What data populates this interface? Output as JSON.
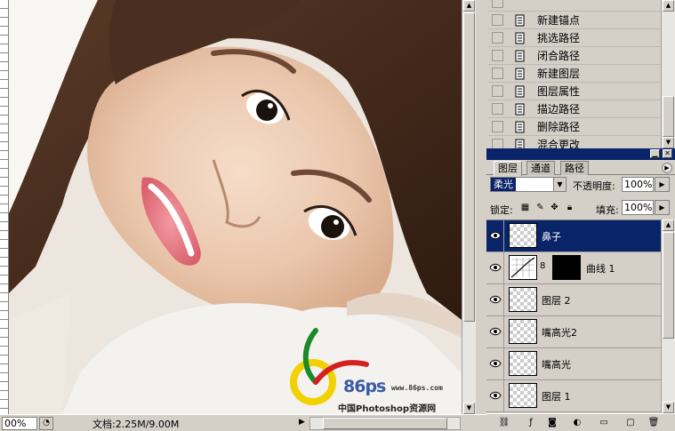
{
  "document": {
    "zoom": "00%",
    "doc_info": "文档:2.25M/9.00M"
  },
  "watermark": {
    "brand": "86ps",
    "url": "www.86ps.com",
    "site_name": "中国Photoshop资源网"
  },
  "history": {
    "items": [
      {
        "label": "新建锚点",
        "icon": "history-state-icon"
      },
      {
        "label": "挑选路径",
        "icon": "history-state-icon"
      },
      {
        "label": "闭合路径",
        "icon": "history-state-icon"
      },
      {
        "label": "新建图层",
        "icon": "history-state-icon"
      },
      {
        "label": "图层属性",
        "icon": "history-state-icon"
      },
      {
        "label": "描边路径",
        "icon": "history-state-icon"
      },
      {
        "label": "删除路径",
        "icon": "history-state-icon"
      },
      {
        "label": "混合更改",
        "icon": "history-state-icon"
      }
    ]
  },
  "layers_panel": {
    "tabs": [
      "图层",
      "通道",
      "路径"
    ],
    "active_tab": "图层",
    "blend_mode": "柔光",
    "opacity_label": "不透明度:",
    "opacity": "100%",
    "lock_label": "锁定:",
    "fill_label": "填充:",
    "fill": "100%",
    "layers": [
      {
        "name": "鼻子",
        "selected": true,
        "visible": true,
        "type": "pixel"
      },
      {
        "name": "曲线 1",
        "selected": false,
        "visible": true,
        "type": "adjustment"
      },
      {
        "name": "图层 2",
        "selected": false,
        "visible": true,
        "type": "pixel"
      },
      {
        "name": "嘴高光2",
        "selected": false,
        "visible": true,
        "type": "pixel"
      },
      {
        "name": "嘴高光",
        "selected": false,
        "visible": true,
        "type": "pixel"
      },
      {
        "name": "图层 1",
        "selected": false,
        "visible": true,
        "type": "pixel"
      }
    ]
  },
  "colors": {
    "selection": "#0a246a",
    "panel_bg": "#d4d0c8"
  }
}
